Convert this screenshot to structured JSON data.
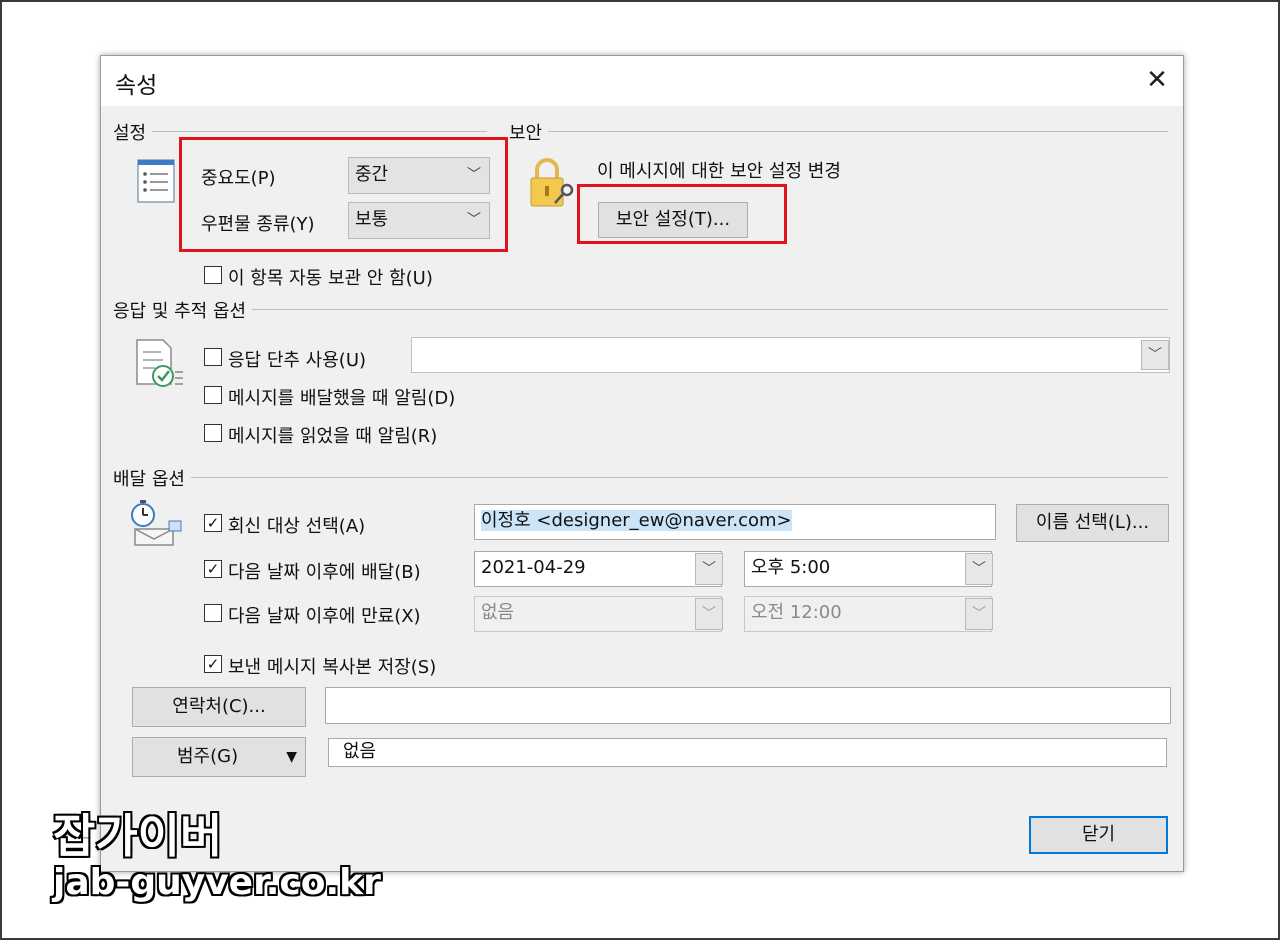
{
  "dialog": {
    "title": "속성"
  },
  "settings": {
    "section_label": "설정",
    "importance_label": "중요도(P)",
    "importance_value": "중간",
    "sensitivity_label": "우편물 종류(Y)",
    "sensitivity_value": "보통",
    "no_autoarchive_label": "이 항목 자동 보관 안 함(U)",
    "no_autoarchive_checked": false
  },
  "security": {
    "section_label": "보안",
    "description": "이 메시지에 대한 보안 설정 변경",
    "button_label": "보안 설정(T)..."
  },
  "voting": {
    "section_label": "응답 및 추적 옵션",
    "use_voting_label": "응답 단추 사용(U)",
    "use_voting_checked": false,
    "voting_value": "",
    "delivery_receipt_label": "메시지를 배달했을 때 알림(D)",
    "delivery_receipt_checked": false,
    "read_receipt_label": "메시지를 읽었을 때 알림(R)",
    "read_receipt_checked": false
  },
  "delivery": {
    "section_label": "배달 옵션",
    "reply_to_label": "회신 대상 선택(A)",
    "reply_to_checked": true,
    "reply_to_value": "이정호 <designer_ew@naver.com>",
    "select_names_label": "이름 선택(L)...",
    "defer_label": "다음 날짜 이후에 배달(B)",
    "defer_checked": true,
    "defer_date": "2021-04-29",
    "defer_time": "오후 5:00",
    "expire_label": "다음 날짜 이후에 만료(X)",
    "expire_checked": false,
    "expire_date": "없음",
    "expire_time": "오전 12:00",
    "save_copy_label": "보낸 메시지 복사본 저장(S)",
    "save_copy_checked": true
  },
  "contacts": {
    "button_label": "연락처(C)...",
    "value": ""
  },
  "categories": {
    "button_label": "범주(G)",
    "value": "없음"
  },
  "close_button": {
    "label": "닫기"
  },
  "watermark": {
    "name": "잡가이버",
    "url": "jab-guyver.co.kr"
  },
  "colors": {
    "highlight": "#e0141c",
    "selection": "#cce4f7",
    "default_button_border": "#0078d7"
  }
}
